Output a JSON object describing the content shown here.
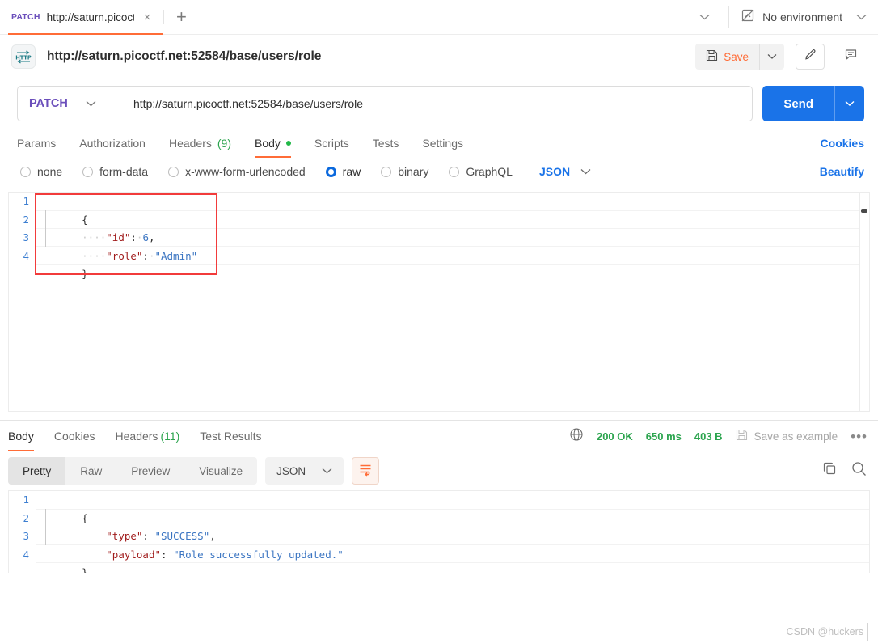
{
  "tabbar": {
    "request_tab": {
      "method": "PATCH",
      "name": "http://saturn.picoct",
      "close_label": "×"
    },
    "new_tab_label": "+",
    "tab_list_chevron": "⌄",
    "environment": {
      "label": "No environment",
      "icon": "no-environment-icon",
      "chevron": "⌄"
    }
  },
  "titlebar": {
    "protocol_badge": "HTTP",
    "url": "http://saturn.picoctf.net:52584/base/users/role",
    "save_label": "Save",
    "save_chevron": "⌄",
    "edit_icon": "pencil-icon",
    "comment_icon": "comment-icon"
  },
  "request": {
    "method": "PATCH",
    "method_chevron": "⌄",
    "url": "http://saturn.picoctf.net:52584/base/users/role",
    "send_label": "Send",
    "send_chevron": "⌄"
  },
  "request_tabs": {
    "items": [
      {
        "label": "Params",
        "active": false
      },
      {
        "label": "Authorization",
        "active": false
      },
      {
        "label": "Headers",
        "count": "(9)",
        "active": false
      },
      {
        "label": "Body",
        "active": true,
        "dot": true
      },
      {
        "label": "Scripts",
        "active": false
      },
      {
        "label": "Tests",
        "active": false
      },
      {
        "label": "Settings",
        "active": false
      }
    ],
    "cookies_link": "Cookies"
  },
  "body_type": {
    "options": [
      {
        "label": "none",
        "selected": false
      },
      {
        "label": "form-data",
        "selected": false
      },
      {
        "label": "x-www-form-urlencoded",
        "selected": false
      },
      {
        "label": "raw",
        "selected": true
      },
      {
        "label": "binary",
        "selected": false
      },
      {
        "label": "GraphQL",
        "selected": false
      }
    ],
    "format": "JSON",
    "format_chevron": "⌄",
    "beautify_link": "Beautify"
  },
  "request_body": {
    "line_numbers": [
      "1",
      "2",
      "3",
      "4"
    ],
    "lines": [
      {
        "n": "1",
        "segments": [
          {
            "t": "brace",
            "v": "{"
          }
        ]
      },
      {
        "n": "2",
        "segments": [
          {
            "t": "ws",
            "v": "····"
          },
          {
            "t": "key",
            "v": "\"id\""
          },
          {
            "t": "punct",
            "v": ":"
          },
          {
            "t": "ws",
            "v": "·"
          },
          {
            "t": "num",
            "v": "6"
          },
          {
            "t": "punct",
            "v": ","
          }
        ]
      },
      {
        "n": "3",
        "segments": [
          {
            "t": "ws",
            "v": "····"
          },
          {
            "t": "key",
            "v": "\"role\""
          },
          {
            "t": "punct",
            "v": ":"
          },
          {
            "t": "ws",
            "v": "·"
          },
          {
            "t": "str",
            "v": "\"Admin\""
          }
        ]
      },
      {
        "n": "4",
        "segments": [
          {
            "t": "brace",
            "v": "}"
          }
        ]
      }
    ],
    "raw_text": "{\n    \"id\": 6,\n    \"role\": \"Admin\"\n}"
  },
  "response_tabs": {
    "items": [
      {
        "label": "Body",
        "active": true
      },
      {
        "label": "Cookies",
        "active": false
      },
      {
        "label": "Headers",
        "count": "(11)",
        "active": false
      },
      {
        "label": "Test Results",
        "active": false
      }
    ],
    "globe_icon": "globe-icon",
    "status": "200 OK",
    "time": "650 ms",
    "size": "403 B",
    "save_example_label": "Save as example",
    "more_label": "•••"
  },
  "response_view": {
    "modes": [
      {
        "label": "Pretty",
        "active": true
      },
      {
        "label": "Raw",
        "active": false
      },
      {
        "label": "Preview",
        "active": false
      },
      {
        "label": "Visualize",
        "active": false
      }
    ],
    "format": "JSON",
    "format_chevron": "⌄",
    "wrap_icon": "wrap-lines-icon",
    "copy_icon": "copy-icon",
    "search_icon": "search-icon"
  },
  "response_body": {
    "lines": [
      {
        "n": "1",
        "segments": [
          {
            "t": "brace",
            "v": "{"
          }
        ]
      },
      {
        "n": "2",
        "segments": [
          {
            "t": "ws",
            "v": "    "
          },
          {
            "t": "key",
            "v": "\"type\""
          },
          {
            "t": "punct",
            "v": ": "
          },
          {
            "t": "str",
            "v": "\"SUCCESS\""
          },
          {
            "t": "punct",
            "v": ","
          }
        ]
      },
      {
        "n": "3",
        "segments": [
          {
            "t": "ws",
            "v": "    "
          },
          {
            "t": "key",
            "v": "\"payload\""
          },
          {
            "t": "punct",
            "v": ": "
          },
          {
            "t": "str",
            "v": "\"Role successfully updated.\""
          }
        ]
      },
      {
        "n": "4",
        "segments": [
          {
            "t": "brace",
            "v": "}"
          }
        ]
      }
    ],
    "raw_text": "{\n    \"type\": \"SUCCESS\",\n    \"payload\": \"Role successfully updated.\"\n}"
  },
  "watermark": "CSDN @huckers",
  "colors": {
    "accent_orange": "#ff6c37",
    "send_blue": "#1a73e8",
    "method_purple": "#6b4fbb",
    "status_green": "#2ba44e",
    "annotation_red": "#f23b3b",
    "json_key": "#a11d1d",
    "json_string": "#3b75c2"
  }
}
